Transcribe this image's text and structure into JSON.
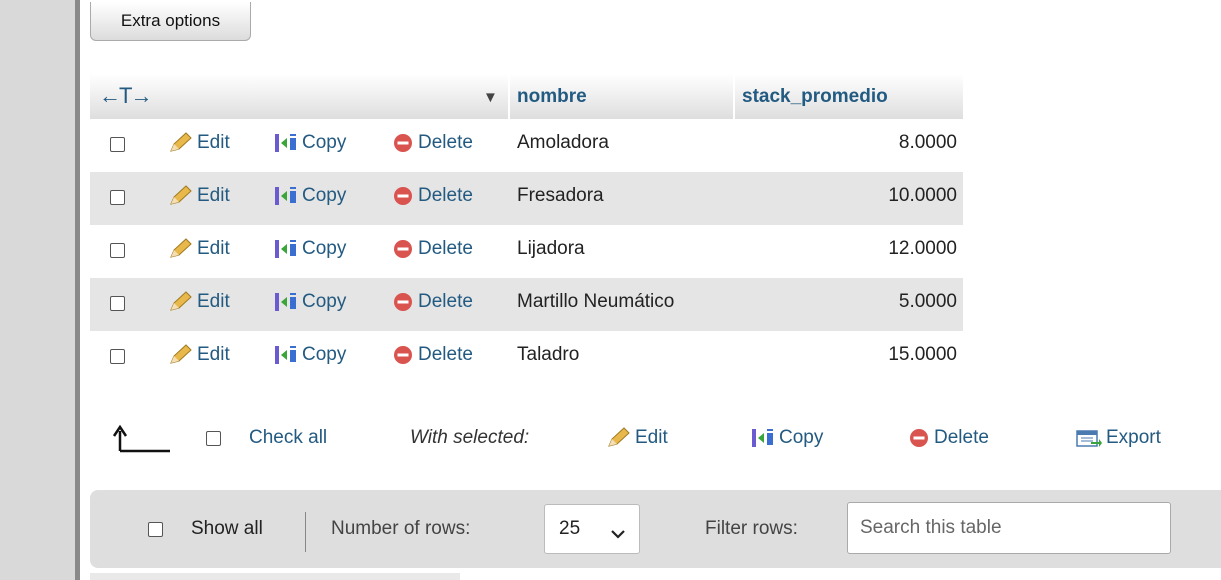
{
  "toolbar": {
    "extra_options": "Extra options"
  },
  "table": {
    "columns": {
      "nombre": "nombre",
      "stack": "stack_promedio"
    },
    "actions": {
      "edit": "Edit",
      "copy": "Copy",
      "delete": "Delete"
    },
    "rows": [
      {
        "nombre": "Amoladora",
        "stack_promedio": "8.0000"
      },
      {
        "nombre": "Fresadora",
        "stack_promedio": "10.0000"
      },
      {
        "nombre": "Lijadora",
        "stack_promedio": "12.0000"
      },
      {
        "nombre": "Martillo Neumático",
        "stack_promedio": "5.0000"
      },
      {
        "nombre": "Taladro",
        "stack_promedio": "15.0000"
      }
    ]
  },
  "bulk": {
    "check_all": "Check all",
    "with_selected": "With selected:",
    "edit": "Edit",
    "copy": "Copy",
    "delete": "Delete",
    "export": "Export"
  },
  "nav": {
    "show_all": "Show all",
    "rows_label": "Number of rows:",
    "rows_value": "25",
    "filter_label": "Filter rows:",
    "filter_placeholder": "Search this table",
    "filter_value": ""
  },
  "colors": {
    "link": "#235a81",
    "row_alt": "#e5e5e5",
    "panel": "#dedede",
    "delete_red": "#d9534f"
  },
  "icons": [
    "pencil-icon",
    "copy-icon",
    "delete-icon",
    "export-icon",
    "arrow-up-left-icon",
    "chevron-down-icon"
  ]
}
